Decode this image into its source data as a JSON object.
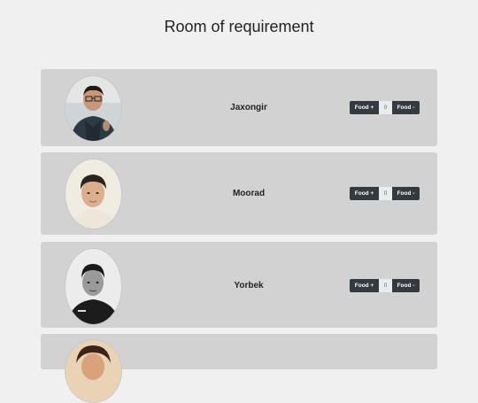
{
  "page": {
    "title": "Room of requirement"
  },
  "people": [
    {
      "name": "Jaxongir",
      "food_plus_label": "Food +",
      "count": "0",
      "food_minus_label": "Food -"
    },
    {
      "name": "Moorad",
      "food_plus_label": "Food +",
      "count": "0",
      "food_minus_label": "Food -"
    },
    {
      "name": "Yorbek",
      "food_plus_label": "Food +",
      "count": "0",
      "food_minus_label": "Food -"
    }
  ],
  "colors": {
    "page_background": "#f0f0f0",
    "card_background": "#d2d2d2",
    "button_background": "#343a40",
    "count_background": "#e9ecef"
  }
}
